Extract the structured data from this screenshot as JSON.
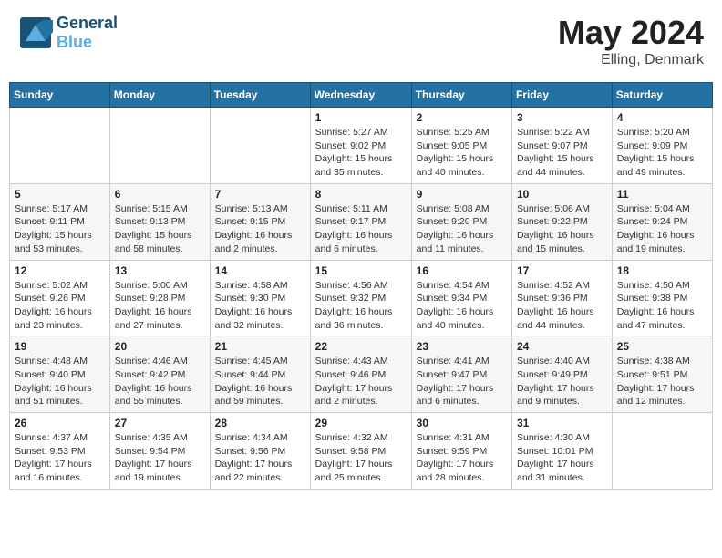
{
  "header": {
    "logo_text_bold": "General",
    "logo_text_light": "Blue",
    "month_year": "May 2024",
    "location": "Elling, Denmark"
  },
  "days_of_week": [
    "Sunday",
    "Monday",
    "Tuesday",
    "Wednesday",
    "Thursday",
    "Friday",
    "Saturday"
  ],
  "weeks": [
    [
      {
        "num": "",
        "info": ""
      },
      {
        "num": "",
        "info": ""
      },
      {
        "num": "",
        "info": ""
      },
      {
        "num": "1",
        "info": "Sunrise: 5:27 AM\nSunset: 9:02 PM\nDaylight: 15 hours and 35 minutes."
      },
      {
        "num": "2",
        "info": "Sunrise: 5:25 AM\nSunset: 9:05 PM\nDaylight: 15 hours and 40 minutes."
      },
      {
        "num": "3",
        "info": "Sunrise: 5:22 AM\nSunset: 9:07 PM\nDaylight: 15 hours and 44 minutes."
      },
      {
        "num": "4",
        "info": "Sunrise: 5:20 AM\nSunset: 9:09 PM\nDaylight: 15 hours and 49 minutes."
      }
    ],
    [
      {
        "num": "5",
        "info": "Sunrise: 5:17 AM\nSunset: 9:11 PM\nDaylight: 15 hours and 53 minutes."
      },
      {
        "num": "6",
        "info": "Sunrise: 5:15 AM\nSunset: 9:13 PM\nDaylight: 15 hours and 58 minutes."
      },
      {
        "num": "7",
        "info": "Sunrise: 5:13 AM\nSunset: 9:15 PM\nDaylight: 16 hours and 2 minutes."
      },
      {
        "num": "8",
        "info": "Sunrise: 5:11 AM\nSunset: 9:17 PM\nDaylight: 16 hours and 6 minutes."
      },
      {
        "num": "9",
        "info": "Sunrise: 5:08 AM\nSunset: 9:20 PM\nDaylight: 16 hours and 11 minutes."
      },
      {
        "num": "10",
        "info": "Sunrise: 5:06 AM\nSunset: 9:22 PM\nDaylight: 16 hours and 15 minutes."
      },
      {
        "num": "11",
        "info": "Sunrise: 5:04 AM\nSunset: 9:24 PM\nDaylight: 16 hours and 19 minutes."
      }
    ],
    [
      {
        "num": "12",
        "info": "Sunrise: 5:02 AM\nSunset: 9:26 PM\nDaylight: 16 hours and 23 minutes."
      },
      {
        "num": "13",
        "info": "Sunrise: 5:00 AM\nSunset: 9:28 PM\nDaylight: 16 hours and 27 minutes."
      },
      {
        "num": "14",
        "info": "Sunrise: 4:58 AM\nSunset: 9:30 PM\nDaylight: 16 hours and 32 minutes."
      },
      {
        "num": "15",
        "info": "Sunrise: 4:56 AM\nSunset: 9:32 PM\nDaylight: 16 hours and 36 minutes."
      },
      {
        "num": "16",
        "info": "Sunrise: 4:54 AM\nSunset: 9:34 PM\nDaylight: 16 hours and 40 minutes."
      },
      {
        "num": "17",
        "info": "Sunrise: 4:52 AM\nSunset: 9:36 PM\nDaylight: 16 hours and 44 minutes."
      },
      {
        "num": "18",
        "info": "Sunrise: 4:50 AM\nSunset: 9:38 PM\nDaylight: 16 hours and 47 minutes."
      }
    ],
    [
      {
        "num": "19",
        "info": "Sunrise: 4:48 AM\nSunset: 9:40 PM\nDaylight: 16 hours and 51 minutes."
      },
      {
        "num": "20",
        "info": "Sunrise: 4:46 AM\nSunset: 9:42 PM\nDaylight: 16 hours and 55 minutes."
      },
      {
        "num": "21",
        "info": "Sunrise: 4:45 AM\nSunset: 9:44 PM\nDaylight: 16 hours and 59 minutes."
      },
      {
        "num": "22",
        "info": "Sunrise: 4:43 AM\nSunset: 9:46 PM\nDaylight: 17 hours and 2 minutes."
      },
      {
        "num": "23",
        "info": "Sunrise: 4:41 AM\nSunset: 9:47 PM\nDaylight: 17 hours and 6 minutes."
      },
      {
        "num": "24",
        "info": "Sunrise: 4:40 AM\nSunset: 9:49 PM\nDaylight: 17 hours and 9 minutes."
      },
      {
        "num": "25",
        "info": "Sunrise: 4:38 AM\nSunset: 9:51 PM\nDaylight: 17 hours and 12 minutes."
      }
    ],
    [
      {
        "num": "26",
        "info": "Sunrise: 4:37 AM\nSunset: 9:53 PM\nDaylight: 17 hours and 16 minutes."
      },
      {
        "num": "27",
        "info": "Sunrise: 4:35 AM\nSunset: 9:54 PM\nDaylight: 17 hours and 19 minutes."
      },
      {
        "num": "28",
        "info": "Sunrise: 4:34 AM\nSunset: 9:56 PM\nDaylight: 17 hours and 22 minutes."
      },
      {
        "num": "29",
        "info": "Sunrise: 4:32 AM\nSunset: 9:58 PM\nDaylight: 17 hours and 25 minutes."
      },
      {
        "num": "30",
        "info": "Sunrise: 4:31 AM\nSunset: 9:59 PM\nDaylight: 17 hours and 28 minutes."
      },
      {
        "num": "31",
        "info": "Sunrise: 4:30 AM\nSunset: 10:01 PM\nDaylight: 17 hours and 31 minutes."
      },
      {
        "num": "",
        "info": ""
      }
    ]
  ]
}
